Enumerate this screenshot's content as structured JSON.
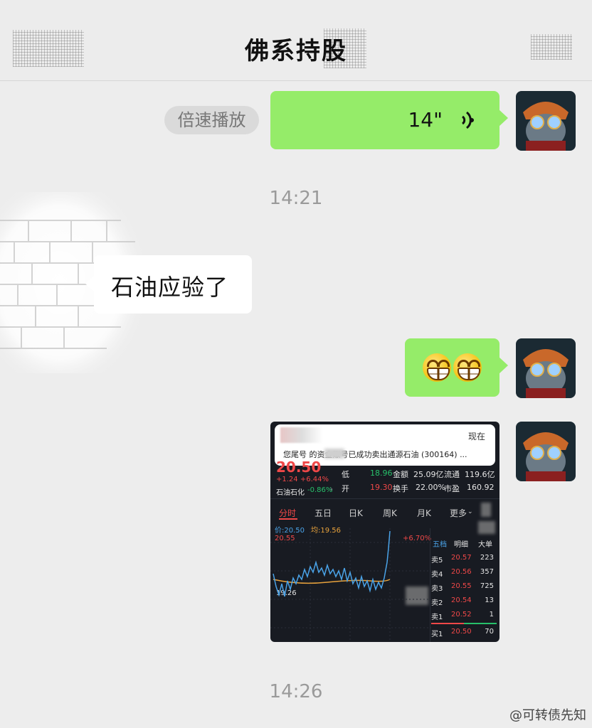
{
  "header": {
    "title": "佛系持股"
  },
  "messages": {
    "voice": {
      "speed_label": "倍速播放",
      "duration": "14\""
    },
    "time1": "14:21",
    "text1": "石油应验了",
    "emoji": [
      "grinning-face",
      "grinning-face"
    ],
    "time2": "14:26"
  },
  "stock": {
    "notification": {
      "now": "现在",
      "message": "您尾号    的资金账号已成功卖出通源石油 (300164) ..."
    },
    "price": "20.50",
    "change": "+1.24 +6.44%",
    "sector": {
      "name": "石油石化",
      "change": "-0.86%"
    },
    "stats": {
      "low_label": "低",
      "low": "18.96",
      "amount_label": "金额",
      "amount": "25.09亿",
      "float_label": "流通",
      "float": "119.6亿",
      "open_label": "开",
      "open": "19.30",
      "turnover_label": "换手",
      "turnover": "22.00%",
      "pe_label": "市盈",
      "pe": "160.92"
    },
    "tabs": [
      "分时",
      "五日",
      "日K",
      "周K",
      "月K",
      "更多"
    ],
    "chart_legend": {
      "price": "价:20.50",
      "avg": "均:19.56"
    },
    "chart_high": "20.55",
    "chart_high_pct": "+6.70%",
    "chart_mid": "19.26",
    "order_book": {
      "headers": [
        "五档",
        "明细",
        "大单"
      ],
      "rows": [
        {
          "label": "卖5",
          "price": "20.57",
          "volume": "223"
        },
        {
          "label": "卖4",
          "price": "20.56",
          "volume": "357"
        },
        {
          "label": "卖3",
          "price": "20.55",
          "volume": "725"
        },
        {
          "label": "卖2",
          "price": "20.54",
          "volume": "13"
        },
        {
          "label": "卖1",
          "price": "20.52",
          "volume": "1"
        },
        {
          "label": "买1",
          "price": "20.50",
          "volume": "70"
        }
      ]
    }
  },
  "watermark": "@可转债先知",
  "colors": {
    "bubble_green": "#95ec69",
    "up_red": "#ef4848",
    "down_green": "#27c06a"
  }
}
